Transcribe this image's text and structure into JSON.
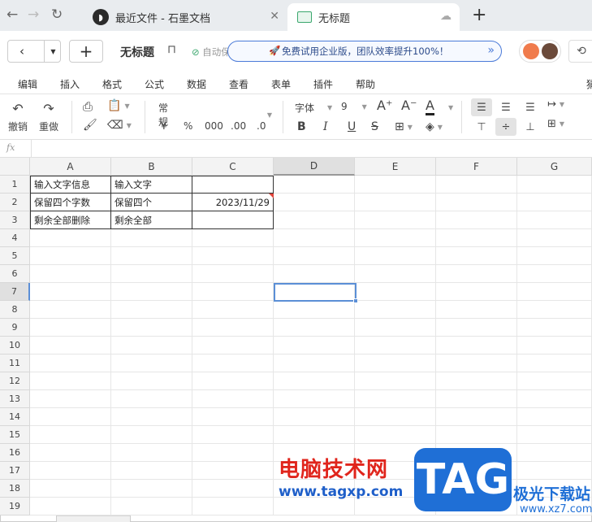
{
  "tabs": [
    {
      "label": "最近文件 - 石墨文档",
      "icon": "shimo-logo-icon"
    },
    {
      "label": "无标题",
      "icon": "sheet-icon"
    }
  ],
  "header": {
    "title": "无标题",
    "autosave": "自动保存成功",
    "promo": "免费试用企业版，团队效率提升100%！",
    "history_icon": "history-icon"
  },
  "menu": [
    "编辑",
    "插入",
    "格式",
    "公式",
    "数据",
    "查看",
    "表单",
    "插件",
    "帮助",
    "猜"
  ],
  "toolbar": {
    "undo": "撤销",
    "redo": "重做",
    "format": "常规",
    "currency": "¥",
    "percent": "%",
    "thousands": "000",
    "dec_inc": ".00",
    "dec_dec": ".0",
    "font": "字体",
    "font_size": "9",
    "bold": "B",
    "italic": "I",
    "underline": "U",
    "strike": "S",
    "font_color": "A"
  },
  "formula_bar": {
    "label": "fx",
    "value": ""
  },
  "columns": [
    "A",
    "B",
    "C",
    "D",
    "E",
    "F",
    "G"
  ],
  "rows": [
    "1",
    "2",
    "3",
    "4",
    "5",
    "6",
    "7",
    "8",
    "9",
    "10",
    "11",
    "12",
    "13",
    "14",
    "15",
    "16",
    "17",
    "18",
    "19"
  ],
  "cells": {
    "A1": "输入文字信息",
    "B1": "输入文字",
    "C1": "",
    "A2": "保留四个字数",
    "B2": "保留四个",
    "C2": "2023/11/29",
    "A3": "剩余全部删除",
    "B3": "剩余全部",
    "C3": ""
  },
  "selected": {
    "column": "D",
    "row": "7"
  },
  "watermark": {
    "cn": "电脑技术网",
    "url": "www.tagxp.com",
    "tag": "TAG",
    "site": "极光下载站",
    "url2": "www.xz7.com"
  },
  "colors": {
    "accent": "#5b8fd6",
    "promo_border": "#4a7ad8",
    "watermark_red": "#e0251c",
    "watermark_blue": "#1f6fd6"
  }
}
